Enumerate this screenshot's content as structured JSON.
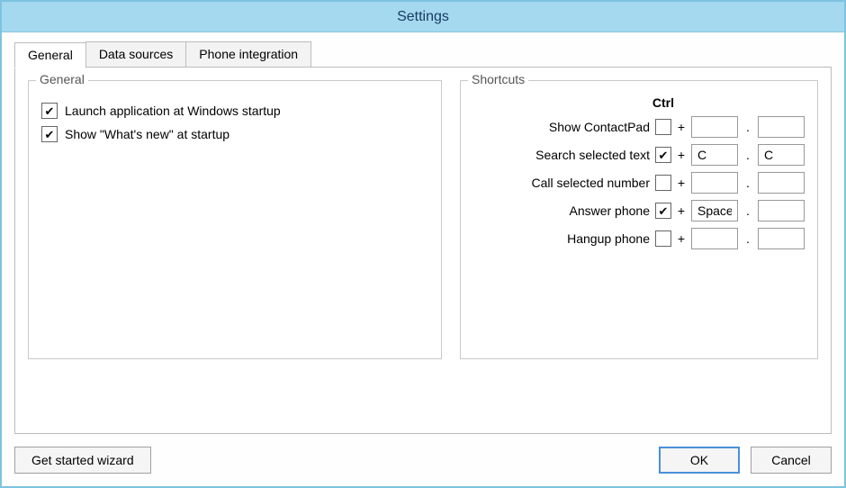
{
  "window": {
    "title": "Settings"
  },
  "tabs": [
    {
      "label": "General"
    },
    {
      "label": "Data sources"
    },
    {
      "label": "Phone integration"
    }
  ],
  "general_group": {
    "legend": "General",
    "launch_label": "Launch application at Windows startup",
    "whatsnew_label": "Show \"What's new\" at startup"
  },
  "shortcuts_group": {
    "legend": "Shortcuts",
    "header": "Ctrl",
    "rows": [
      {
        "label": "Show ContactPad",
        "checked": false,
        "key1": "",
        "key2": ""
      },
      {
        "label": "Search selected text",
        "checked": true,
        "key1": "C",
        "key2": "C"
      },
      {
        "label": "Call selected number",
        "checked": false,
        "key1": "",
        "key2": ""
      },
      {
        "label": "Answer phone",
        "checked": true,
        "key1": "Space",
        "key2": ""
      },
      {
        "label": "Hangup phone",
        "checked": false,
        "key1": "",
        "key2": ""
      }
    ],
    "plus": "+",
    "dot": "."
  },
  "buttons": {
    "wizard": "Get started wizard",
    "ok": "OK",
    "cancel": "Cancel"
  }
}
